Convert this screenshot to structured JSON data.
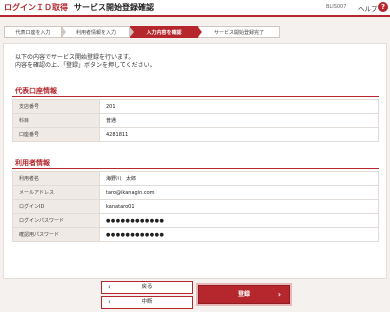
{
  "header": {
    "login_label": "ログインＩＤ取得",
    "page_title": "サービス開始登録確認",
    "screen_code": "BLIS007",
    "help_label": "ヘルプ",
    "help_icon": "?"
  },
  "steps": [
    {
      "label": "代表口座を入力"
    },
    {
      "label": "利用者情報を入力"
    },
    {
      "label": "入力内容を確認"
    },
    {
      "label": "サービス開始登録完了"
    }
  ],
  "intro": {
    "line1": "以下の内容でサービス開始登録を行います。",
    "line2": "内容を確認の上、「登録」ボタンを押してください。"
  },
  "account_section": {
    "title": "代表口座情報",
    "rows": [
      {
        "label": "支店番号",
        "value": "201"
      },
      {
        "label": "科目",
        "value": "普通"
      },
      {
        "label": "口座番号",
        "value": "4281811"
      }
    ]
  },
  "user_section": {
    "title": "利用者情報",
    "rows": [
      {
        "label": "利用者名",
        "value": "海野川　太郎"
      },
      {
        "label": "メールアドレス",
        "value": "taro@ikanagin.com"
      },
      {
        "label": "ログインID",
        "value": "kanataro01"
      },
      {
        "label": "ログインパスワード",
        "value": "●●●●●●●●●●●●"
      },
      {
        "label": "確認用パスワード",
        "value": "●●●●●●●●●●●●"
      }
    ]
  },
  "buttons": {
    "back_label": "戻る",
    "cancel_label": "中断",
    "register_label": "登録",
    "chevron_left": "‹",
    "chevron_right": "›"
  },
  "colors": {
    "accent": "#b5272d",
    "background": "#f4f1ee",
    "label_cell": "#efeae6"
  }
}
